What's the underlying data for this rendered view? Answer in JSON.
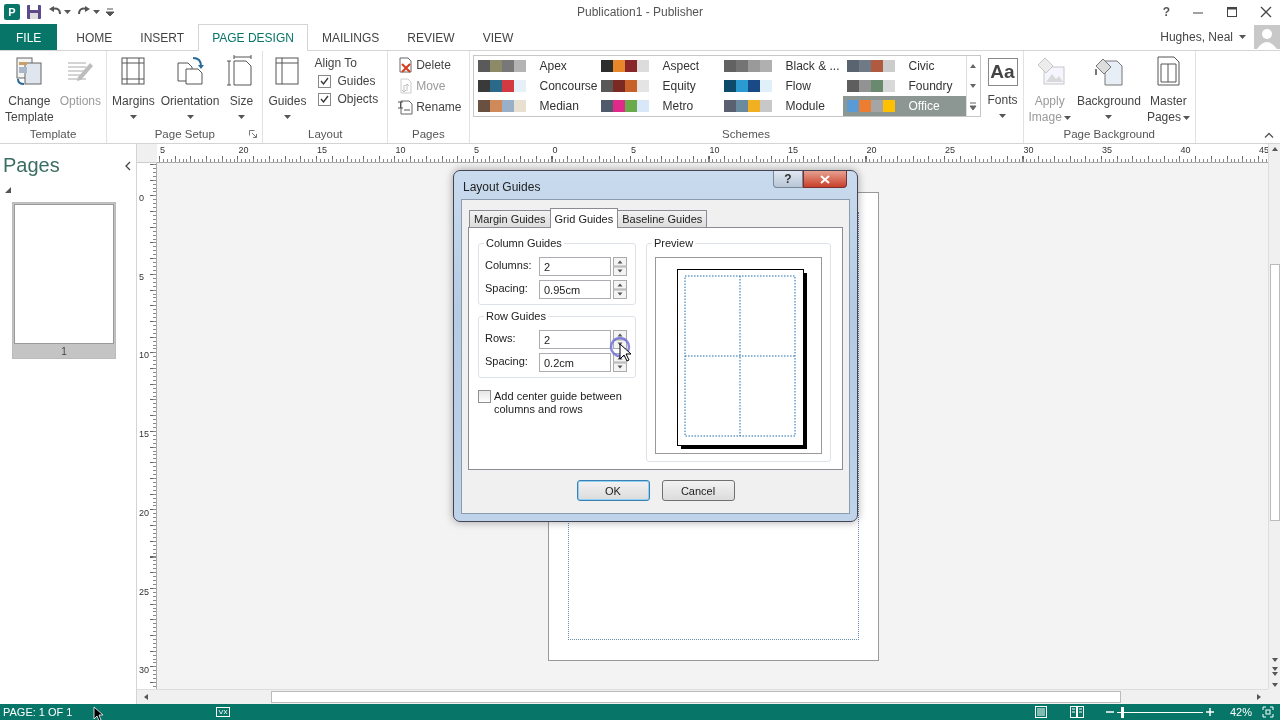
{
  "window": {
    "title": "Publication1 - Publisher",
    "help": "?"
  },
  "app_icon": {
    "letter": "P"
  },
  "tabs": [
    {
      "label": "FILE",
      "kind": "file",
      "selected": false
    },
    {
      "label": "HOME",
      "kind": "tab",
      "selected": false
    },
    {
      "label": "INSERT",
      "kind": "tab",
      "selected": false
    },
    {
      "label": "PAGE DESIGN",
      "kind": "tab",
      "selected": true
    },
    {
      "label": "MAILINGS",
      "kind": "tab",
      "selected": false
    },
    {
      "label": "REVIEW",
      "kind": "tab",
      "selected": false
    },
    {
      "label": "VIEW",
      "kind": "tab",
      "selected": false
    }
  ],
  "user": {
    "name": "Hughes, Neal"
  },
  "ribbon": {
    "groups": [
      {
        "label": "Template",
        "items": [
          {
            "kind": "large",
            "label": "Change Template",
            "disabled": false
          },
          {
            "kind": "large",
            "label": "Options",
            "disabled": true
          }
        ]
      },
      {
        "label": "Page Setup",
        "launcher": true,
        "items": [
          {
            "kind": "large",
            "label": "Margins",
            "dropdown": true,
            "disabled": false
          },
          {
            "kind": "large",
            "label": "Orientation",
            "dropdown": true,
            "disabled": false
          },
          {
            "kind": "large",
            "label": "Size",
            "dropdown": true,
            "disabled": false
          }
        ]
      },
      {
        "label": "Layout",
        "items": [
          {
            "kind": "large",
            "label": "Guides",
            "dropdown": true,
            "disabled": false
          },
          {
            "kind": "checks",
            "heading": "Align To",
            "checks": [
              {
                "label": "Guides",
                "checked": true
              },
              {
                "label": "Objects",
                "checked": true
              }
            ]
          }
        ]
      },
      {
        "label": "Pages",
        "items": [
          {
            "kind": "smalls",
            "buttons": [
              {
                "label": "Delete",
                "disabled": false
              },
              {
                "label": "Move",
                "disabled": true
              },
              {
                "label": "Rename",
                "disabled": false
              }
            ]
          }
        ]
      },
      {
        "label": "Schemes",
        "items": [
          {
            "kind": "gallery",
            "schemes": [
              {
                "name": "Apex",
                "selected": false,
                "swatches": [
                  {
                    "color": "#5a5a5a"
                  },
                  {
                    "color": "#8c8a68"
                  },
                  {
                    "color": "#787878"
                  },
                  {
                    "color": "#b4b4b4"
                  }
                ]
              },
              {
                "name": "Aspect",
                "selected": false,
                "swatches": [
                  {
                    "color": "#2d2d2d"
                  },
                  {
                    "color": "#e8862a"
                  },
                  {
                    "color": "#88262a"
                  },
                  {
                    "color": "#dcdcdc"
                  }
                ]
              },
              {
                "name": "Black & ...",
                "selected": false,
                "swatches": [
                  {
                    "color": "#626262"
                  },
                  {
                    "color": "#747474"
                  },
                  {
                    "color": "#9a9a9a"
                  },
                  {
                    "color": "#b0b0b0"
                  }
                ]
              },
              {
                "name": "Civic",
                "selected": false,
                "swatches": [
                  {
                    "color": "#5a6470"
                  },
                  {
                    "color": "#707a86"
                  },
                  {
                    "color": "#b05a40"
                  },
                  {
                    "color": "#cccccc"
                  }
                ]
              },
              {
                "name": "Concourse",
                "selected": false,
                "swatches": [
                  {
                    "color": "#3a3a3a"
                  },
                  {
                    "color": "#2a6a88"
                  },
                  {
                    "color": "#d03a40"
                  },
                  {
                    "color": "#e6f0f8"
                  }
                ]
              },
              {
                "name": "Equity",
                "selected": false,
                "swatches": [
                  {
                    "color": "#585858"
                  },
                  {
                    "color": "#7a2a22"
                  },
                  {
                    "color": "#c8602a"
                  },
                  {
                    "color": "#e4e4e4"
                  }
                ]
              },
              {
                "name": "Flow",
                "selected": false,
                "swatches": [
                  {
                    "color": "#0e4a6a"
                  },
                  {
                    "color": "#2a9ad0"
                  },
                  {
                    "color": "#1a4a86"
                  },
                  {
                    "color": "#e0f0f8"
                  }
                ]
              },
              {
                "name": "Foundry",
                "selected": false,
                "swatches": [
                  {
                    "color": "#5e5e5e"
                  },
                  {
                    "color": "#929292"
                  },
                  {
                    "color": "#6a8a70"
                  },
                  {
                    "color": "#d8d8d8"
                  }
                ]
              },
              {
                "name": "Median",
                "selected": false,
                "swatches": [
                  {
                    "color": "#6a5040"
                  },
                  {
                    "color": "#d08a5a"
                  },
                  {
                    "color": "#9ab0c8"
                  },
                  {
                    "color": "#e8e0d0"
                  }
                ]
              },
              {
                "name": "Metro",
                "selected": false,
                "swatches": [
                  {
                    "color": "#505a6a"
                  },
                  {
                    "color": "#e02a8a"
                  },
                  {
                    "color": "#6aaa4a"
                  },
                  {
                    "color": "#d8e8f8"
                  }
                ]
              },
              {
                "name": "Module",
                "selected": false,
                "swatches": [
                  {
                    "color": "#5a6070"
                  },
                  {
                    "color": "#6a8aa0"
                  },
                  {
                    "color": "#f0b020"
                  },
                  {
                    "color": "#c8c8c8"
                  }
                ]
              },
              {
                "name": "Office",
                "selected": true,
                "swatches": [
                  {
                    "color": "#5b9bd5"
                  },
                  {
                    "color": "#ed7d31"
                  },
                  {
                    "color": "#a5a5a5"
                  },
                  {
                    "color": "#ffc000"
                  }
                ]
              }
            ]
          },
          {
            "kind": "large",
            "glyph": "Aa",
            "label": "Fonts",
            "dropdown": true,
            "disabled": false
          }
        ]
      },
      {
        "label": "Page Background",
        "items": [
          {
            "kind": "large",
            "label": "Apply Image",
            "dropdown": true,
            "disabled": true
          },
          {
            "kind": "large",
            "label": "Background",
            "dropdown": true,
            "disabled": false
          },
          {
            "kind": "large",
            "label": "Master Pages",
            "dropdown": true,
            "disabled": false
          }
        ]
      }
    ]
  },
  "pages_pane": {
    "title": "Pages",
    "pages": [
      {
        "label": "1",
        "selected": true
      }
    ]
  },
  "rulers": {
    "horizontal": [
      "5",
      "20",
      "15",
      "10",
      "5",
      "0",
      "5",
      "10",
      "15",
      "20",
      "25",
      "30",
      "35",
      "40",
      "45"
    ],
    "vertical": [
      "0",
      "5",
      "10",
      "15",
      "20",
      "25",
      "30"
    ]
  },
  "dialog": {
    "title": "Layout Guides",
    "help": "?",
    "tabs": [
      {
        "label": "Margin Guides",
        "selected": false
      },
      {
        "label": "Grid Guides",
        "selected": true
      },
      {
        "label": "Baseline Guides",
        "selected": false
      }
    ],
    "groups": [
      {
        "label": "Column Guides",
        "fields": [
          {
            "label": "Columns:",
            "value": "2"
          },
          {
            "label": "Spacing:",
            "value": "0.95cm"
          }
        ]
      },
      {
        "label": "Row Guides",
        "fields": [
          {
            "label": "Rows:",
            "value": "2"
          },
          {
            "label": "Spacing:",
            "value": "0.2cm"
          }
        ]
      }
    ],
    "center_guide": {
      "label": "Add center guide between columns and rows",
      "checked": false
    },
    "preview": {
      "label": "Preview"
    },
    "buttons": [
      {
        "label": "OK",
        "default": true
      },
      {
        "label": "Cancel",
        "default": false
      }
    ]
  },
  "status_bar": {
    "page": "PAGE: 1 OF 1",
    "zoom": {
      "level": 0.06,
      "reading": "42%"
    }
  }
}
